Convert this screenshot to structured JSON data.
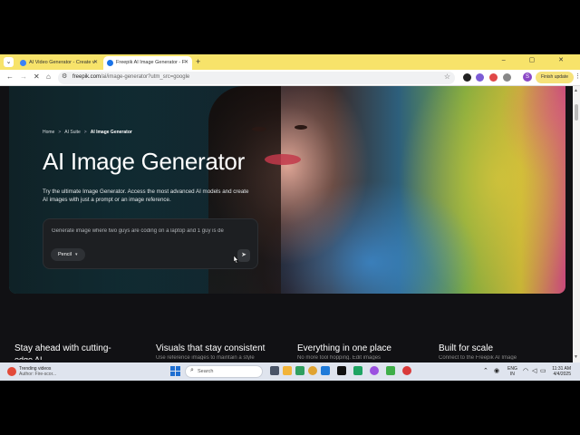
{
  "browser": {
    "tabs": [
      {
        "title": "AI Video Generator - Create v",
        "active": false,
        "favicon_color": "#3b82f6"
      },
      {
        "title": "Freepik AI Image Generator - F",
        "active": true,
        "favicon_color": "#1a73e8"
      }
    ],
    "new_tab_glyph": "+",
    "window_controls": "– ▢ ✕",
    "url_host": "freepik.com",
    "url_path": "/ai/image-generator?utm_src=google",
    "finish_update_label": "Finish update",
    "profile_initial": "S"
  },
  "page": {
    "breadcrumb": [
      "Home",
      "AI Suite",
      "AI Image Generator"
    ],
    "breadcrumb_sep": ">",
    "title": "AI Image Generator",
    "description": "Try the ultimate Image Generator. Access the most advanced AI models and create AI images with just a prompt or an image reference.",
    "prompt_value": "Generate image where two guys are coding on a laptop and 1 guy is de",
    "model_button_label": "Pencil",
    "send_icon": "send-icon",
    "features": [
      {
        "title": "Stay ahead with cutting-",
        "sub": "edge AI"
      },
      {
        "title": "Visuals that stay consistent",
        "sub": "Use reference images to maintain a style"
      },
      {
        "title": "Everything in one place",
        "sub": "No more tool hopping. Edit images"
      },
      {
        "title": "Built for scale",
        "sub": "Connect to the Freepik AI Image"
      }
    ]
  },
  "taskbar": {
    "news_line1": "Trending videos",
    "news_line2": "Author: Fire-scor...",
    "search_placeholder": "Search",
    "lang_line1": "ENG",
    "lang_line2": "IN",
    "time": "11:31 AM",
    "date": "4/4/2025"
  },
  "colors": {
    "accent_tabbar": "#f7e36a",
    "page_bg": "#111114"
  }
}
